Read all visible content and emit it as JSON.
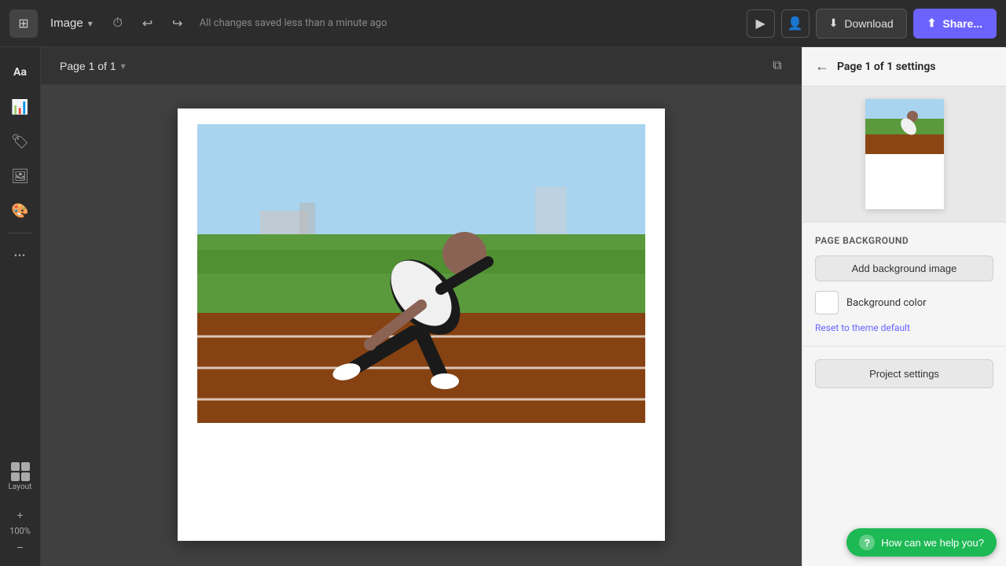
{
  "topbar": {
    "app_icon": "📄",
    "doc_name": "Image",
    "undo_icon": "↩",
    "redo_icon": "↪",
    "history_icon": "⏱",
    "save_status": "All changes saved less than a minute ago",
    "present_icon": "▶",
    "collab_icon": "👤",
    "download_label": "Download",
    "share_label": "Share...",
    "download_icon": "⬇"
  },
  "left_sidebar": {
    "icons": [
      {
        "name": "text-icon",
        "symbol": "Aa",
        "label": "Text"
      },
      {
        "name": "charts-icon",
        "symbol": "📊",
        "label": "Charts"
      },
      {
        "name": "elements-icon",
        "symbol": "🏷",
        "label": "Elements"
      },
      {
        "name": "photos-icon",
        "symbol": "🖼",
        "label": "Photos"
      },
      {
        "name": "brand-icon",
        "symbol": "🎨",
        "label": "Brand"
      }
    ],
    "more_icon": "•••",
    "layout_label": "Layout",
    "zoom_value": "100%",
    "zoom_in": "+",
    "zoom_out": "−"
  },
  "canvas": {
    "page_label": "Page 1 of 1",
    "duplicate_icon": "⧉"
  },
  "right_panel": {
    "back_icon": "←",
    "title": "Page 1 of 1 settings",
    "section_bg_label": "Page background",
    "add_bg_btn": "Add background image",
    "bg_color_label": "Background color",
    "reset_label": "Reset to theme default",
    "project_settings_label": "Project settings"
  },
  "help": {
    "icon": "?",
    "label": "How can we help you?"
  },
  "colors": {
    "brand_purple": "#6c63ff",
    "brand_green": "#1db954",
    "bg_color_swatch": "#ffffff"
  }
}
